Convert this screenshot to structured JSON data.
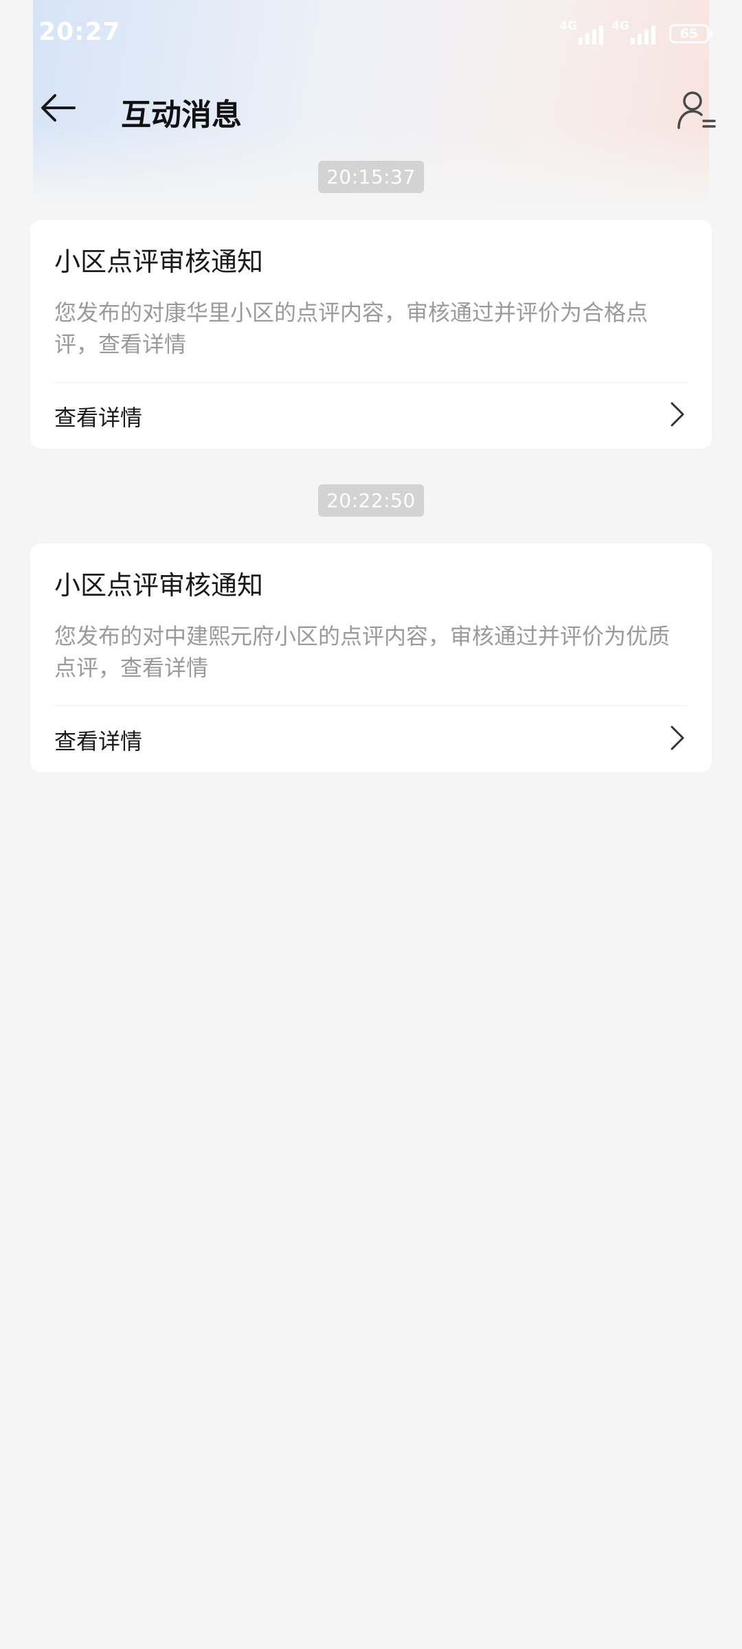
{
  "status_bar": {
    "time": "20:27",
    "network_1": "4G",
    "network_2": "4G",
    "battery": "65"
  },
  "header": {
    "title": "互动消息"
  },
  "messages": [
    {
      "timestamp": "20:15:37",
      "title": "小区点评审核通知",
      "body": "您发布的对康华里小区的点评内容，审核通过并评价为合格点评，查看详情",
      "action": "查看详情"
    },
    {
      "timestamp": "20:22:50",
      "title": "小区点评审核通知",
      "body": "您发布的对中建熙元府小区的点评内容，审核通过并评价为优质点评，查看详情",
      "action": "查看详情"
    }
  ],
  "colors": {
    "background": "#f5f5f5",
    "card": "#ffffff",
    "badge": "#d3d3d3",
    "body_text": "#9a9a9a"
  },
  "icons": {
    "back": "back-arrow-icon",
    "user": "user-list-icon",
    "chevron": "chevron-right-icon"
  }
}
